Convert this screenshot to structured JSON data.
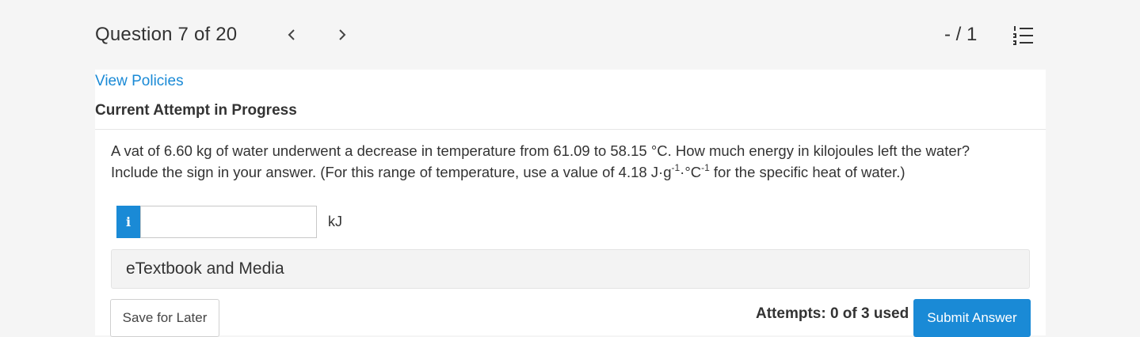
{
  "header": {
    "question_label": "Question 7 of 20",
    "prev_icon": "chevron-left-icon",
    "next_icon": "chevron-right-icon",
    "score": "- / 1",
    "list_icon": "numbered-list-icon"
  },
  "main": {
    "policies_link": "View Policies",
    "attempt_heading": "Current Attempt in Progress",
    "question": {
      "part1": "A vat of  6.60  kg of water underwent a decrease in temperature from  61.09  to  58.15 °C. How much energy in kilojoules left the water? Include the sign in your answer. (For this range of temperature, use a value of 4.18 J·g",
      "sup1": "-1",
      "part2": "·°C",
      "sup2": "-1",
      "part3": " for the specific heat of water.)"
    },
    "answer": {
      "info_label": "i",
      "value": "",
      "placeholder": "",
      "unit": "kJ"
    },
    "media_label": "eTextbook and Media",
    "save_label": "Save for Later",
    "attempts_text": "Attempts: 0 of 3 used",
    "submit_label": "Submit Answer"
  },
  "colors": {
    "accent": "#1a8ad6",
    "page_background": "#f5f5f5",
    "panel_background": "#ffffff"
  }
}
